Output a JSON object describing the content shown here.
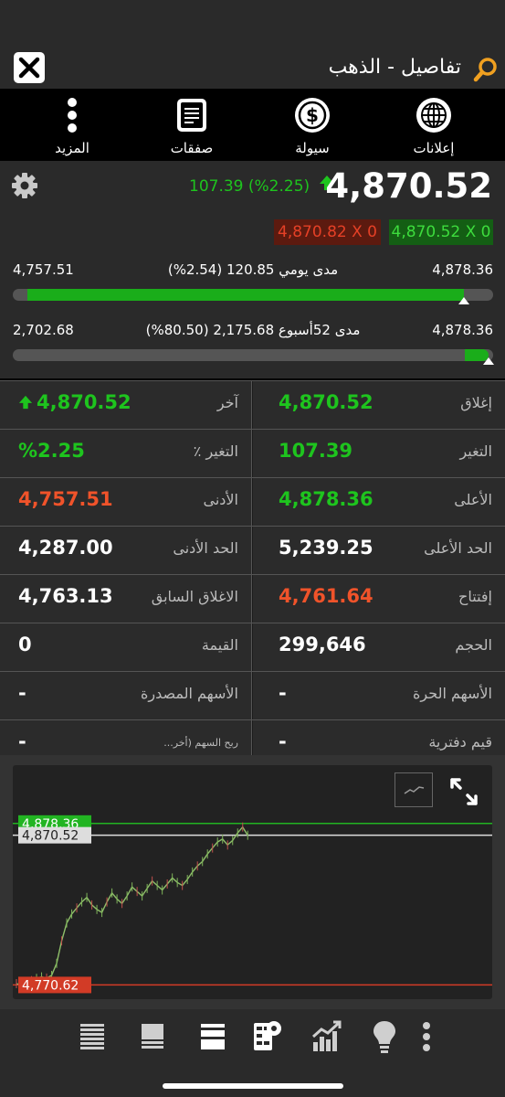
{
  "header": {
    "title": "تفاصيل - الذهب"
  },
  "toolbar": [
    {
      "key": "ads",
      "label": "إعلانات"
    },
    {
      "key": "liquidity",
      "label": "سيولة"
    },
    {
      "key": "trades",
      "label": "صفقات"
    },
    {
      "key": "more",
      "label": "المزيد"
    }
  ],
  "quote": {
    "price": "4,870.52",
    "change_text": "107.39 (%2.25)",
    "bid": "4,870.52 X 0",
    "ask": "4,870.82 X 0",
    "daily_range": {
      "low": "4,757.51",
      "high": "4,878.36",
      "label": "مدى يومي 120.85 (2.54%)",
      "position": 0.94
    },
    "week52_range": {
      "low": "2,702.68",
      "high": "4,878.36",
      "label": "مدى 52أسبوع 2,175.68 (80.50%)",
      "position": 0.99
    }
  },
  "stats": [
    {
      "right_label": "إغلاق",
      "right_value": "4,870.52",
      "right_color": "green",
      "left_label": "آخر",
      "left_value": "4,870.52",
      "left_color": "green",
      "left_arrow": true
    },
    {
      "right_label": "التغير",
      "right_value": "107.39",
      "right_color": "green",
      "left_label": "التغير ٪",
      "left_value": "%2.25",
      "left_color": "green"
    },
    {
      "right_label": "الأعلى",
      "right_value": "4,878.36",
      "right_color": "green",
      "left_label": "الأدنى",
      "left_value": "4,757.51",
      "left_color": "red"
    },
    {
      "right_label": "الحد الأعلى",
      "right_value": "5,239.25",
      "right_color": "white",
      "left_label": "الحد الأدنى",
      "left_value": "4,287.00",
      "left_color": "white"
    },
    {
      "right_label": "إفتتاح",
      "right_value": "4,761.64",
      "right_color": "red",
      "left_label": "الاغلاق السابق",
      "left_value": "4,763.13",
      "left_color": "white"
    },
    {
      "right_label": "الحجم",
      "right_value": "299,646",
      "right_color": "white",
      "left_label": "القيمة",
      "left_value": "0",
      "left_color": "white"
    },
    {
      "right_label": "الأسهم الحرة",
      "right_value": "-",
      "right_color": "white",
      "left_label": "الأسهم المصدرة",
      "left_value": "-",
      "left_color": "white"
    },
    {
      "right_label": "قيم دفترية",
      "right_value": "-",
      "right_color": "white",
      "left_label": "ربح السهم (أخر...",
      "left_value": "-",
      "left_color": "white",
      "left_small": true
    }
  ],
  "chart_data": {
    "type": "line",
    "levels": {
      "high": "4,878.36",
      "last": "4,870.52",
      "low": "4,770.62"
    },
    "high": 4878.36,
    "last": 4870.52,
    "low": 4770.62,
    "ylim": [
      4766,
      4888
    ],
    "values": [
      4771.5,
      4770.6,
      4772.0,
      4773.5,
      4775.0,
      4776.0,
      4775.2,
      4777.0,
      4785.0,
      4800.0,
      4812.0,
      4818.0,
      4822.0,
      4826.0,
      4829.0,
      4824.0,
      4821.0,
      4819.0,
      4826.0,
      4832.0,
      4828.0,
      4825.0,
      4830.0,
      4836.0,
      4833.0,
      4830.0,
      4835.0,
      4840.0,
      4837.0,
      4834.0,
      4838.0,
      4842.0,
      4839.0,
      4837.0,
      4841.0,
      4846.0,
      4850.0,
      4853.0,
      4858.0,
      4862.0,
      4866.0,
      4868.0,
      4864.0,
      4867.0,
      4872.0,
      4876.0,
      4870.52
    ],
    "colors": {
      "high": "#22b422",
      "last": "#dddddd",
      "low": "#d23b26"
    }
  },
  "nav": [
    "market-list-icon",
    "sectors-icon",
    "watchlist-icon",
    "tools-icon",
    "chart-icon",
    "ideas-icon",
    "more-icon"
  ]
}
